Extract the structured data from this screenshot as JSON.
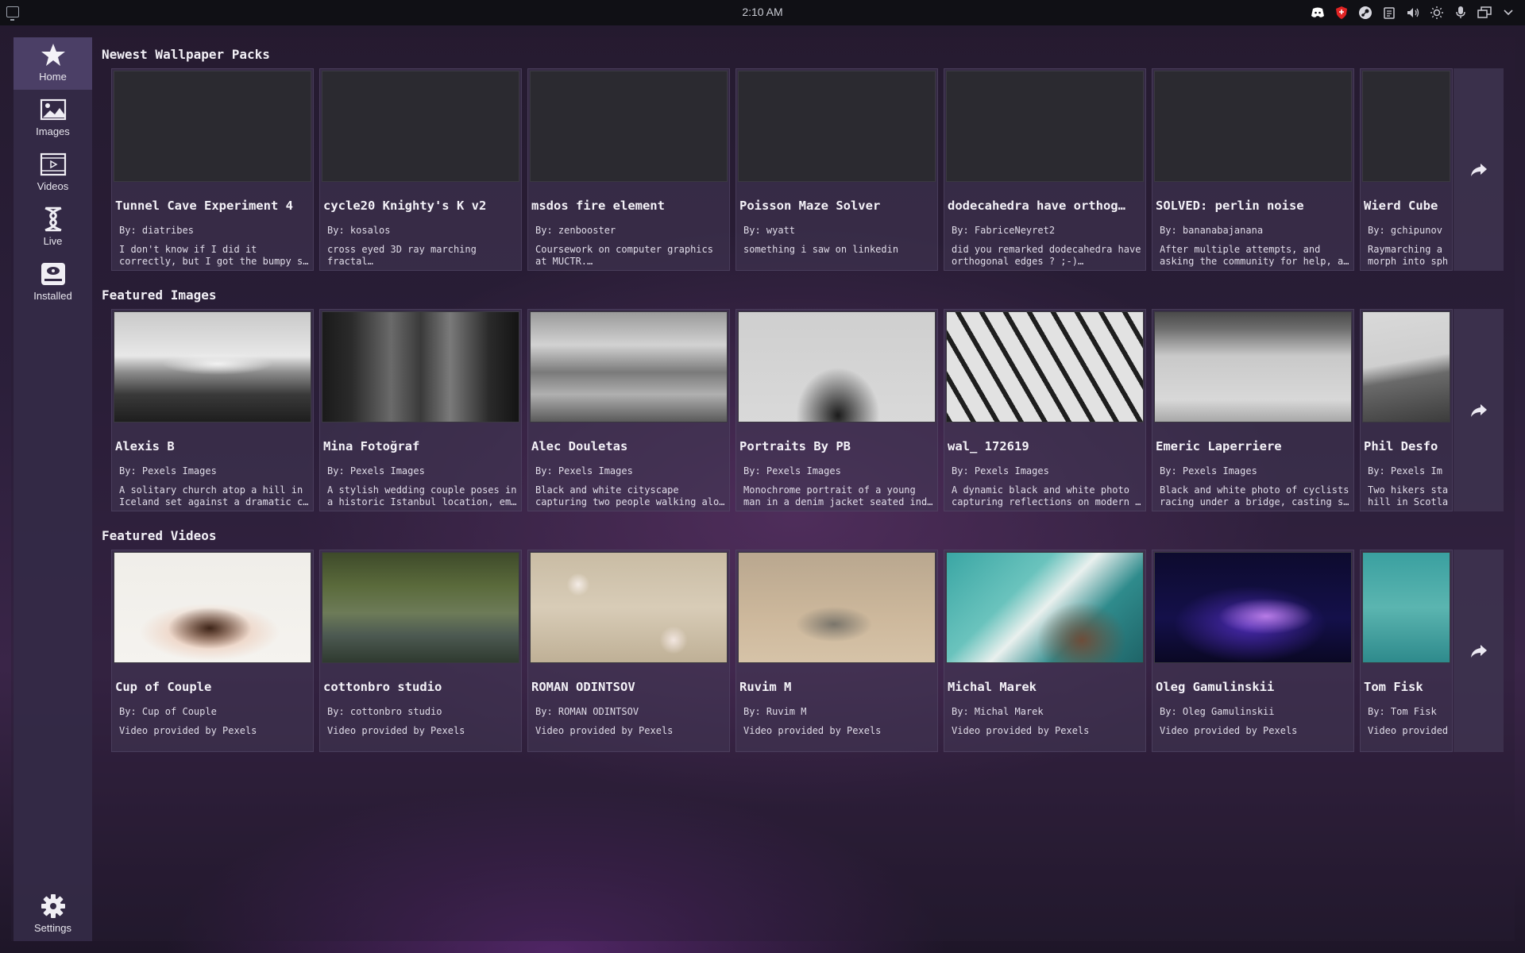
{
  "system_bar": {
    "clock": "2:10 AM",
    "tray_icons": [
      "discord-icon",
      "shield-icon",
      "steam-icon",
      "clipboard-icon",
      "volume-icon",
      "brightness-icon",
      "microphone-icon",
      "windows-icon",
      "chevron-down-icon"
    ]
  },
  "sidebar": {
    "items": [
      {
        "label": "Home",
        "icon": "star-icon",
        "active": true
      },
      {
        "label": "Images",
        "icon": "image-icon",
        "active": false
      },
      {
        "label": "Videos",
        "icon": "video-icon",
        "active": false
      },
      {
        "label": "Live",
        "icon": "dna-icon",
        "active": false
      },
      {
        "label": "Installed",
        "icon": "drive-icon",
        "active": false
      }
    ],
    "settings_label": "Settings"
  },
  "sections": {
    "packs": {
      "title": "Newest Wallpaper Packs",
      "cards": [
        {
          "title": "Tunnel Cave Experiment 4",
          "author": "By: diatribes",
          "desc": "I don't know if I did it correctly, but I got the bumpy s…"
        },
        {
          "title": "cycle20 Knighty's K v2",
          "author": "By: kosalos",
          "desc": "cross eyed 3D ray marching fractal…"
        },
        {
          "title": "msdos fire element",
          "author": "By: zenbooster",
          "desc": "Coursework on computer graphics at MUCTR.…"
        },
        {
          "title": "Poisson Maze Solver",
          "author": "By: wyatt",
          "desc": "something i saw on linkedin"
        },
        {
          "title": "dodecahedra have orthog…",
          "author": "By: FabriceNeyret2",
          "desc": "did you remarked dodecahedra have orthogonal edges ? ;-)…"
        },
        {
          "title": "SOLVED: perlin noise",
          "author": "By: bananabajanana",
          "desc": "After multiple attempts, and asking the community for help, a…"
        },
        {
          "title": "Wierd Cube",
          "author": "By: gchipunov",
          "desc": "Raymarching a morph into sph"
        }
      ]
    },
    "images": {
      "title": "Featured Images",
      "cards": [
        {
          "title": "Alexis B",
          "author": "By: Pexels Images",
          "desc": "A solitary church atop a hill in Iceland set against a dramatic c…",
          "thumb": "church"
        },
        {
          "title": "Mina Fotoğraf",
          "author": "By: Pexels Images",
          "desc": "A stylish wedding couple poses in a historic Istanbul location, em…",
          "thumb": "wedding"
        },
        {
          "title": "Alec Douletas",
          "author": "By: Pexels Images",
          "desc": "Black and white cityscape capturing two people walking alo…",
          "thumb": "city"
        },
        {
          "title": "Portraits By PB",
          "author": "By: Pexels Images",
          "desc": "Monochrome portrait of a young man in a denim jacket seated ind…",
          "thumb": "portrait"
        },
        {
          "title": "wal_ 172619",
          "author": "By: Pexels Images",
          "desc": "A dynamic black and white photo capturing reflections on modern …",
          "thumb": "arch"
        },
        {
          "title": "Emeric Laperriere",
          "author": "By: Pexels Images",
          "desc": "Black and white photo of cyclists racing under a bridge, casting s…",
          "thumb": "bridge"
        },
        {
          "title": "Phil Desfo",
          "author": "By: Pexels Im",
          "desc": "Two hikers sta hill in Scotla",
          "thumb": "hill"
        }
      ]
    },
    "videos": {
      "title": "Featured Videos",
      "cards": [
        {
          "title": "Cup of  Couple",
          "author": "By: Cup of  Couple",
          "desc": "Video provided by Pexels",
          "thumb": "hands"
        },
        {
          "title": "cottonbro studio",
          "author": "By: cottonbro studio",
          "desc": "Video provided by Pexels",
          "thumb": "forest"
        },
        {
          "title": "ROMAN ODINTSOV",
          "author": "By: ROMAN ODINTSOV",
          "desc": "Video provided by Pexels",
          "thumb": "blossom"
        },
        {
          "title": "Ruvim M",
          "author": "By: Ruvim M",
          "desc": "Video provided by Pexels",
          "thumb": "seal"
        },
        {
          "title": "Michal Marek",
          "author": "By: Michal Marek",
          "desc": "Video provided by Pexels",
          "thumb": "coast"
        },
        {
          "title": "Oleg Gamulinskii",
          "author": "By: Oleg Gamulinskii",
          "desc": "Video provided by Pexels",
          "thumb": "particles"
        },
        {
          "title": "Tom Fisk",
          "author": "By: Tom Fisk",
          "desc": "Video provided",
          "thumb": "sea"
        }
      ]
    }
  },
  "colors": {
    "sidebar_bg": "#342a46",
    "sidebar_active": "#4b3f66",
    "card_bg": "#443856",
    "accent_red": "#e02424"
  }
}
